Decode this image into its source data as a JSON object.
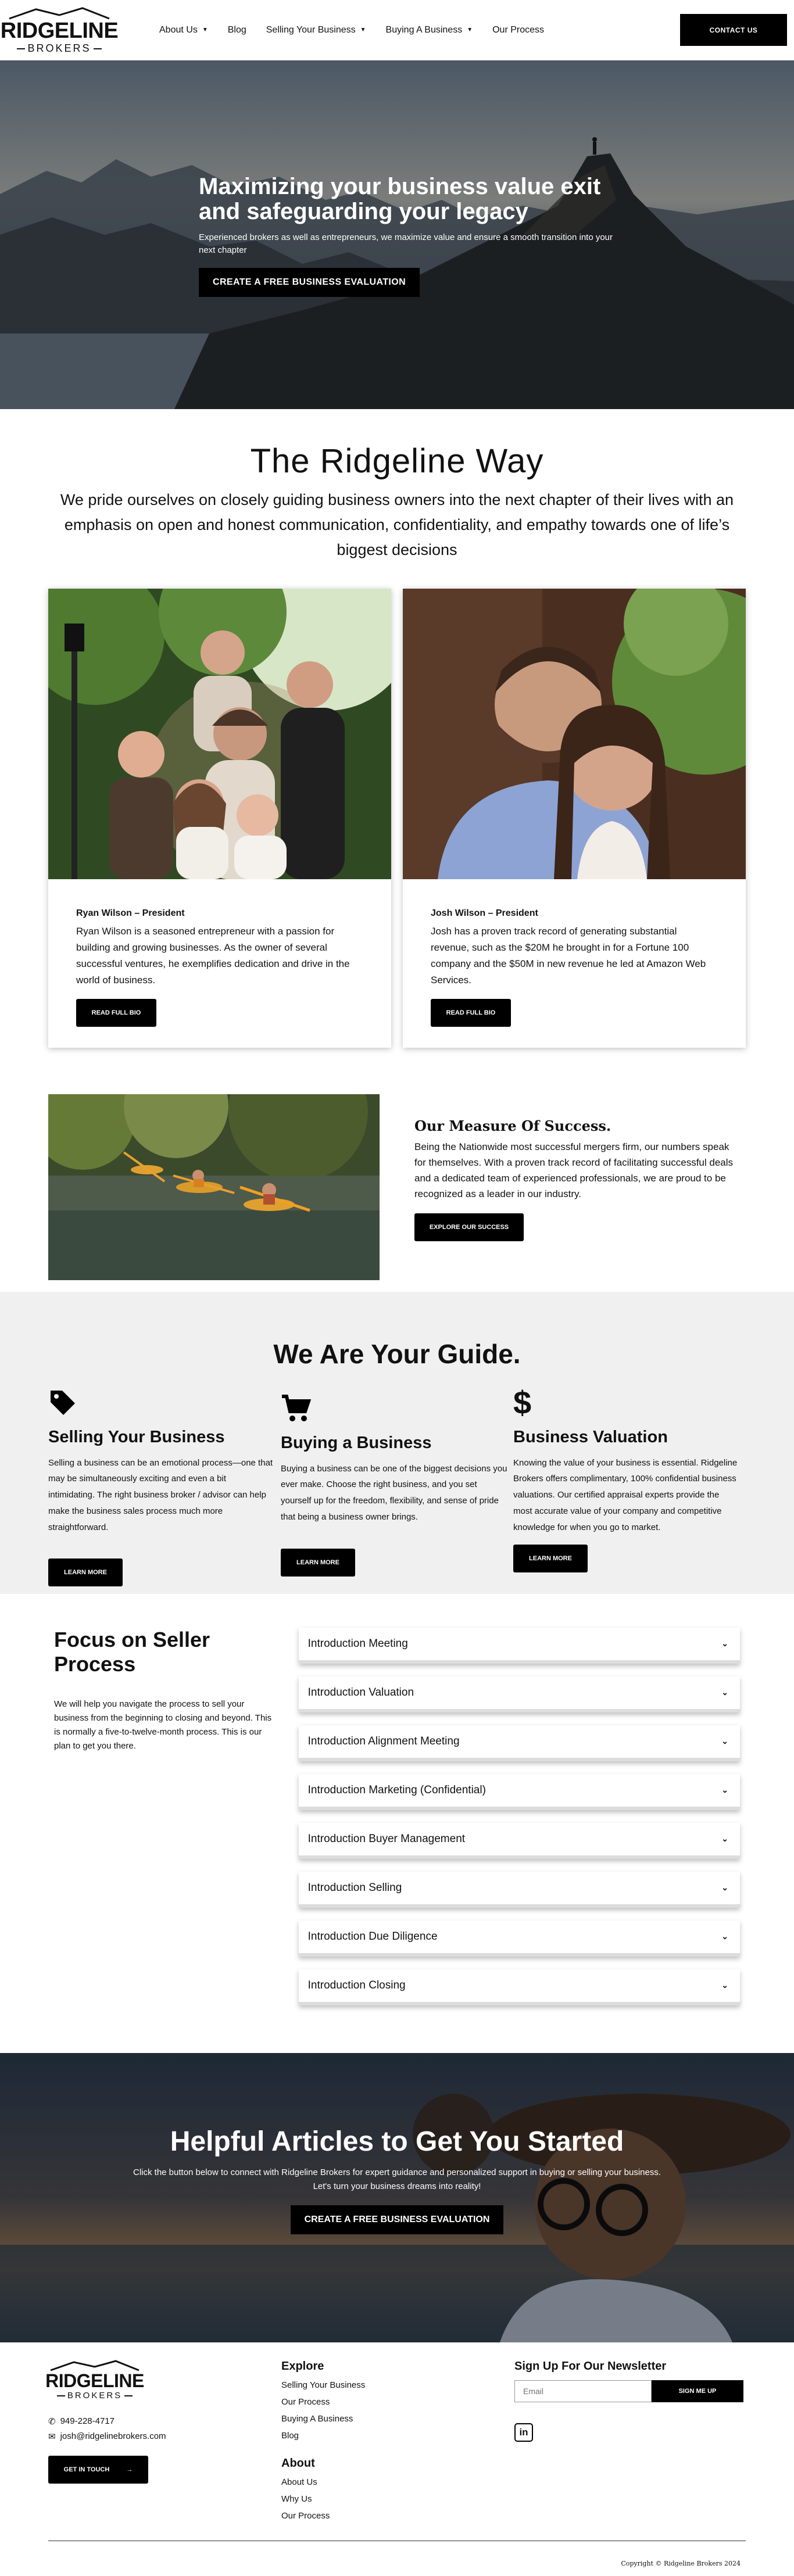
{
  "header": {
    "logo_main": "RIDGELINE",
    "logo_sub": "BROKERS",
    "nav": [
      {
        "label": "About Us",
        "has_caret": true
      },
      {
        "label": "Blog",
        "has_caret": false
      },
      {
        "label": "Selling Your Business",
        "has_caret": true
      },
      {
        "label": "Buying A Business",
        "has_caret": true
      },
      {
        "label": "Our Process",
        "has_caret": false
      }
    ],
    "caret_glyph": "▼",
    "contact_label": "CONTACT US"
  },
  "hero": {
    "title": "Maximizing your business value exit and safeguarding your legacy",
    "subtitle": "Experienced brokers as well as entrepreneurs, we maximize value and ensure a smooth transition into your next chapter",
    "button": "CREATE A FREE BUSINESS EVALUATION"
  },
  "way": {
    "title": "The Ridgeline Way",
    "text": "We pride ourselves on closely guiding business owners into the next chapter of their lives with an emphasis on open and honest communication, confidentiality, and empathy towards one of life’s biggest decisions"
  },
  "people": [
    {
      "name": "Ryan Wilson – President",
      "bio": "Ryan Wilson is a seasoned entrepreneur with a passion for building and growing businesses. As the owner of several successful ventures, he exemplifies dedication and drive in the world of business.",
      "button": "READ FULL BIO"
    },
    {
      "name": "Josh Wilson – President",
      "bio": "Josh has a proven track record of generating substantial revenue, such as the $20M he brought in for a Fortune 100 company and the $50M in new revenue he led at Amazon Web Services.",
      "button": "READ FULL BIO"
    }
  ],
  "success": {
    "title": "Our Measure Of Success.",
    "body": "Being the Nationwide most successful mergers firm, our numbers speak for themselves. With a proven track record of facilitating successful deals and a dedicated team of experienced professionals, we are proud to be recognized as a leader in our industry.",
    "button": "EXPLORE OUR SUCCESS"
  },
  "guide": {
    "title": "We Are Your Guide.",
    "columns": [
      {
        "icon": "tag-icon",
        "heading": "Selling Your Business",
        "body": "Selling a business can be an emotional process—one that may be simultaneously exciting and even a bit intimidating. The right business broker / advisor can help make the business sales process much more straightforward.",
        "button": "LEARN MORE"
      },
      {
        "icon": "cart-icon",
        "heading": "Buying a Business",
        "body": "Buying a business can be one of the biggest decisions you ever make. Choose the right business, and you set yourself up for the freedom, flexibility, and sense of pride that being a business owner brings.",
        "button": "LEARN MORE"
      },
      {
        "icon": "dollar-icon",
        "heading": "Business Valuation",
        "body": "Knowing the value of your business is essential. Ridgeline Brokers offers complimentary, 100% confidential business valuations. Our certified appraisal experts provide the most accurate value of your company and competitive knowledge for when you go to market.",
        "button": "LEARN MORE"
      }
    ]
  },
  "process": {
    "title": "Focus on Seller Process",
    "body": "We will help you navigate the process to sell your business from the beginning to closing and beyond. This is normally a five-to-twelve-month process. This is our plan to get you there.",
    "chevron_glyph": "⌄",
    "items": [
      "Introduction Meeting",
      "Introduction Valuation",
      "Introduction Alignment Meeting",
      "Introduction Marketing (Confidential)",
      "Introduction Buyer Management",
      "Introduction Selling",
      "Introduction Due Diligence",
      "Introduction Closing"
    ]
  },
  "articles": {
    "title": "Helpful Articles to Get You Started",
    "subtitle": "Click the button below to connect with Ridgeline Brokers for expert guidance and personalized support in buying or selling your business. Let's turn your business dreams into reality!",
    "button": "CREATE A FREE BUSINESS EVALUATION"
  },
  "footer": {
    "logo_main": "RIDGELINE",
    "logo_sub": "BROKERS",
    "phone": "949-228-4717",
    "email": "josh@ridgelinebrokers.com",
    "get_in_touch": "GET IN TOUCH",
    "arrow": "→",
    "explore_title": "Explore",
    "explore_links": [
      "Selling Your Business",
      "Our Process",
      "Buying A Business",
      "Blog"
    ],
    "about_title": "About",
    "about_links": [
      "About Us",
      "Why Us",
      "Our Process"
    ],
    "newsletter_title": "Sign Up For Our Newsletter",
    "email_placeholder": "Email",
    "signup_label": "SIGN ME UP",
    "linkedin_label": "in",
    "copyright": "Copyright © Ridgeline Brokers 2024"
  },
  "colors": {
    "primary": "#000000",
    "guide_bg": "#f0f0f0",
    "text": "#111111"
  }
}
